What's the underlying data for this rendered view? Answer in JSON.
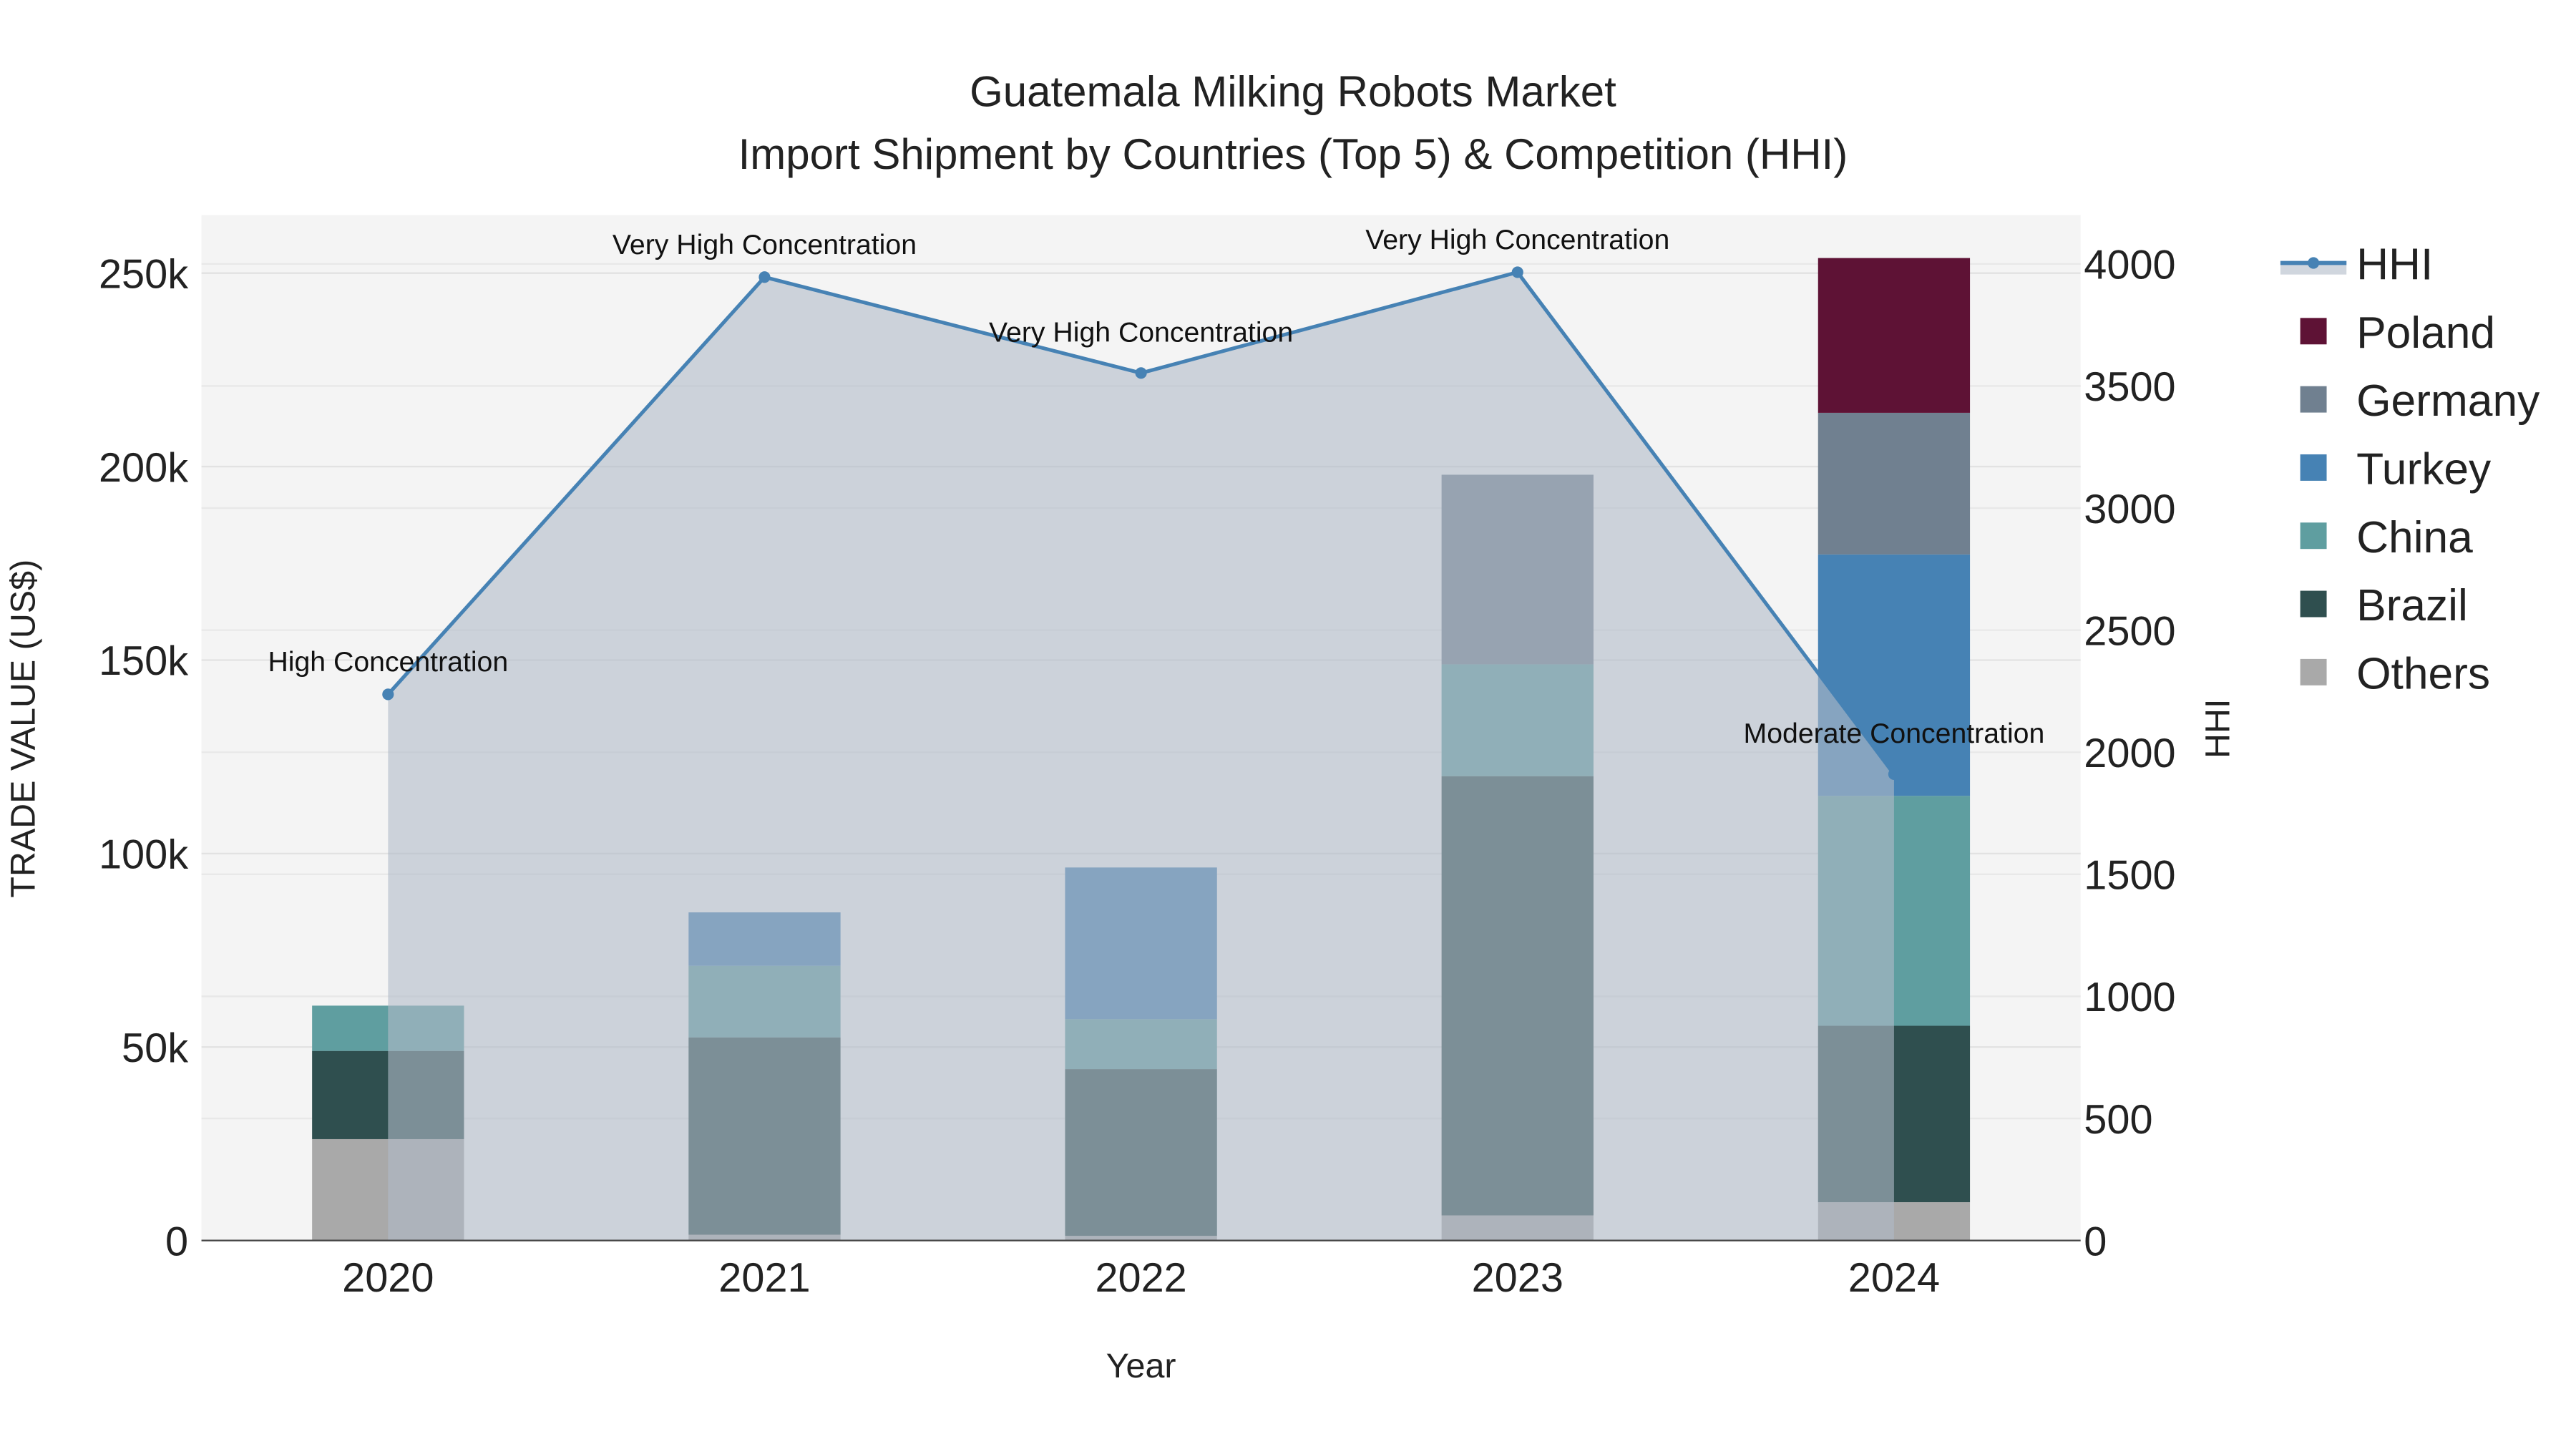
{
  "chart_data": {
    "type": "bar",
    "title": "Guatemala Milking Robots Market",
    "subtitle": "Import Shipment by Countries (Top 5) & Competition (HHI)",
    "xlabel": "Year",
    "ylabel": "TRADE VALUE (US$)",
    "y2label": "HHI",
    "categories": [
      "2020",
      "2021",
      "2022",
      "2023",
      "2024"
    ],
    "ylim": [
      0,
      265000
    ],
    "y2lim": [
      0,
      4200
    ],
    "yticks": [
      0,
      50000,
      100000,
      150000,
      200000,
      250000
    ],
    "ytick_labels": [
      "0",
      "50k",
      "100k",
      "150k",
      "200k",
      "250k"
    ],
    "y2ticks": [
      0,
      500,
      1000,
      1500,
      2000,
      2500,
      3000,
      3500,
      4000
    ],
    "y2tick_labels": [
      "0",
      "500",
      "1000",
      "1500",
      "2000",
      "2500",
      "3000",
      "3500",
      "4000"
    ],
    "stacked": true,
    "series": [
      {
        "name": "Others",
        "color": "#a9a9a9",
        "values": [
          26200,
          1500,
          1200,
          6500,
          9900
        ]
      },
      {
        "name": "Brazil",
        "color": "#2f4f4f",
        "values": [
          22800,
          51000,
          43100,
          113500,
          45600
        ]
      },
      {
        "name": "China",
        "color": "#5f9ea0",
        "values": [
          11700,
          18500,
          12900,
          28900,
          59400
        ]
      },
      {
        "name": "Turkey",
        "color": "#4682b4",
        "values": [
          0,
          13800,
          39200,
          0,
          62400
        ]
      },
      {
        "name": "Germany",
        "color": "#708090",
        "values": [
          0,
          0,
          0,
          49000,
          36600
        ]
      },
      {
        "name": "Poland",
        "color": "#5e1235",
        "values": [
          0,
          0,
          0,
          0,
          40000
        ]
      }
    ],
    "hhi": {
      "name": "HHI",
      "color": "#4682b4",
      "values": [
        2237,
        3946,
        3553,
        3966,
        1910
      ],
      "annotations": [
        "High Concentration",
        "Very High Concentration",
        "Very High Concentration",
        "Very High Concentration",
        "Moderate Concentration"
      ]
    },
    "legend": [
      "HHI",
      "Poland",
      "Germany",
      "Turkey",
      "China",
      "Brazil",
      "Others"
    ],
    "legend_position": "right",
    "grid": true
  }
}
